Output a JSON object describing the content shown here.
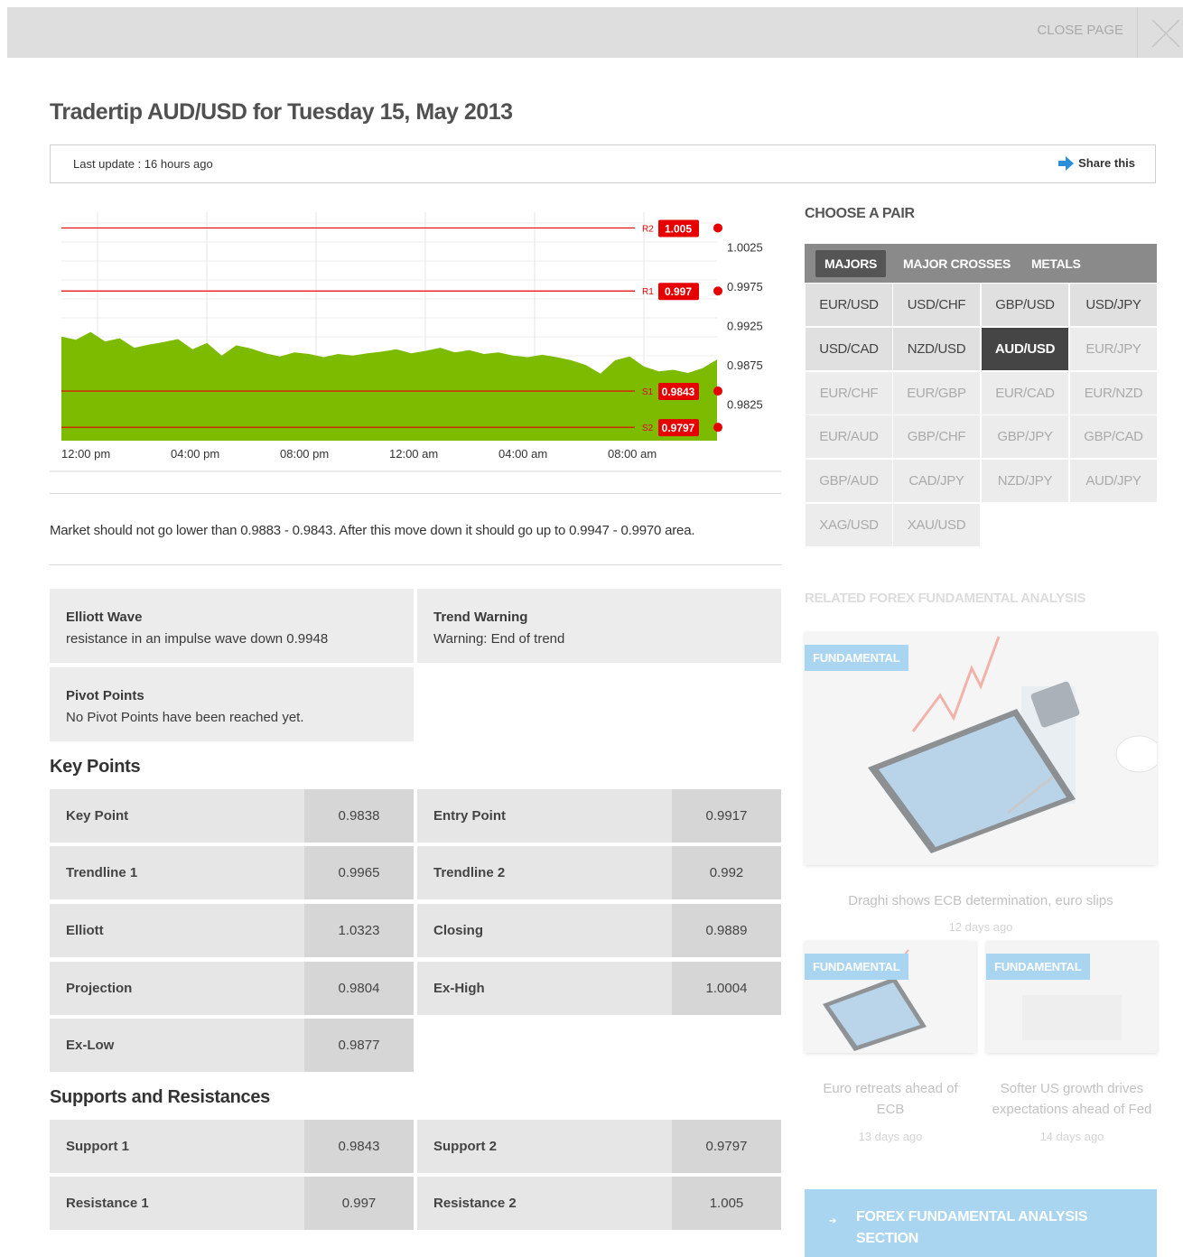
{
  "top_bar": {
    "close_label": "CLOSE PAGE"
  },
  "page_title": "Tradertip AUD/USD for Tuesday 15, May 2013",
  "update_bar": {
    "last_update": "Last update : 16 hours ago",
    "share_label": "Share this"
  },
  "chart_data": {
    "type": "area",
    "x_ticks": [
      "12:00 pm",
      "04:00 pm",
      "08:00 pm",
      "12:00 am",
      "04:00 am",
      "08:00 am"
    ],
    "y_ticks": [
      "1.0025",
      "0.9975",
      "0.9925",
      "0.9875",
      "0.9825"
    ],
    "ylim": [
      0.978,
      1.007
    ],
    "fill_color": "#7dbb00",
    "level_color": "#e60000",
    "series": [
      {
        "values": [
          0.9912,
          0.9908,
          0.9918,
          0.9906,
          0.991,
          0.9898,
          0.9902,
          0.9905,
          0.9909,
          0.9896,
          0.9904,
          0.9888,
          0.9901,
          0.9897,
          0.9891,
          0.9887,
          0.9892,
          0.989,
          0.9886,
          0.989,
          0.9888,
          0.9891,
          0.9893,
          0.9896,
          0.9891,
          0.9894,
          0.9898,
          0.9892,
          0.9895,
          0.989,
          0.9892,
          0.9888,
          0.9886,
          0.9889,
          0.9886,
          0.9882,
          0.9876,
          0.9865,
          0.9882,
          0.9887,
          0.9874,
          0.9868,
          0.987,
          0.9866,
          0.9872,
          0.9883
        ]
      }
    ],
    "levels": [
      {
        "name": "R2",
        "value": 1.005,
        "label": "1.005"
      },
      {
        "name": "R1",
        "value": 0.997,
        "label": "0.997"
      },
      {
        "name": "S1",
        "value": 0.9843,
        "label": "0.9843"
      },
      {
        "name": "S2",
        "value": 0.9797,
        "label": "0.9797"
      }
    ]
  },
  "summary": "Market should not go lower than 0.9883 - 0.9843. After this move down it should go up to 0.9947 - 0.9970 area.",
  "info": {
    "elliott_title": "Elliott Wave",
    "elliott_text": "resistance in an impulse wave down 0.9948",
    "trend_title": "Trend Warning",
    "trend_text": "Warning: End of trend",
    "pivot_title": "Pivot Points",
    "pivot_text": "No Pivot Points have been reached yet."
  },
  "key_points": {
    "title": "Key Points",
    "rows": [
      {
        "k": "Key Point",
        "v": "0.9838"
      },
      {
        "k": "Entry Point",
        "v": "0.9917"
      },
      {
        "k": "Trendline 1",
        "v": "0.9965"
      },
      {
        "k": "Trendline 2",
        "v": "0.992"
      },
      {
        "k": "Elliott",
        "v": "1.0323"
      },
      {
        "k": "Closing",
        "v": "0.9889"
      },
      {
        "k": "Projection",
        "v": "0.9804"
      },
      {
        "k": "Ex-High",
        "v": "1.0004"
      },
      {
        "k": "Ex-Low",
        "v": "0.9877"
      }
    ]
  },
  "supports": {
    "title": "Supports and Resistances",
    "rows": [
      {
        "k": "Support 1",
        "v": "0.9843"
      },
      {
        "k": "Support 2",
        "v": "0.9797"
      },
      {
        "k": "Resistance 1",
        "v": "0.997"
      },
      {
        "k": "Resistance 2",
        "v": "1.005"
      }
    ]
  },
  "pair_panel": {
    "title": "CHOOSE A PAIR",
    "tabs": [
      "MAJORS",
      "MAJOR CROSSES",
      "METALS"
    ],
    "pairs": [
      "EUR/USD",
      "USD/CHF",
      "GBP/USD",
      "USD/JPY",
      "USD/CAD",
      "NZD/USD",
      "AUD/USD",
      "EUR/JPY",
      "EUR/CHF",
      "EUR/GBP",
      "EUR/CAD",
      "EUR/NZD",
      "EUR/AUD",
      "GBP/CHF",
      "GBP/JPY",
      "GBP/CAD",
      "GBP/AUD",
      "CAD/JPY",
      "NZD/JPY",
      "AUD/JPY",
      "XAG/USD",
      "XAU/USD"
    ],
    "selected": "AUD/USD"
  },
  "related": {
    "title": "RELATED FOREX FUNDAMENTAL ANALYSIS",
    "badge": "FUNDAMENTAL",
    "items": [
      {
        "title": "Draghi shows ECB determination, euro slips",
        "time": "12 days ago"
      },
      {
        "title": "Euro retreats ahead of ECB",
        "time": "13 days ago"
      },
      {
        "title": "Softer US growth drives expectations ahead of Fed",
        "time": "14 days ago"
      }
    ],
    "cta": "FOREX FUNDAMENTAL ANALYSIS SECTION"
  }
}
